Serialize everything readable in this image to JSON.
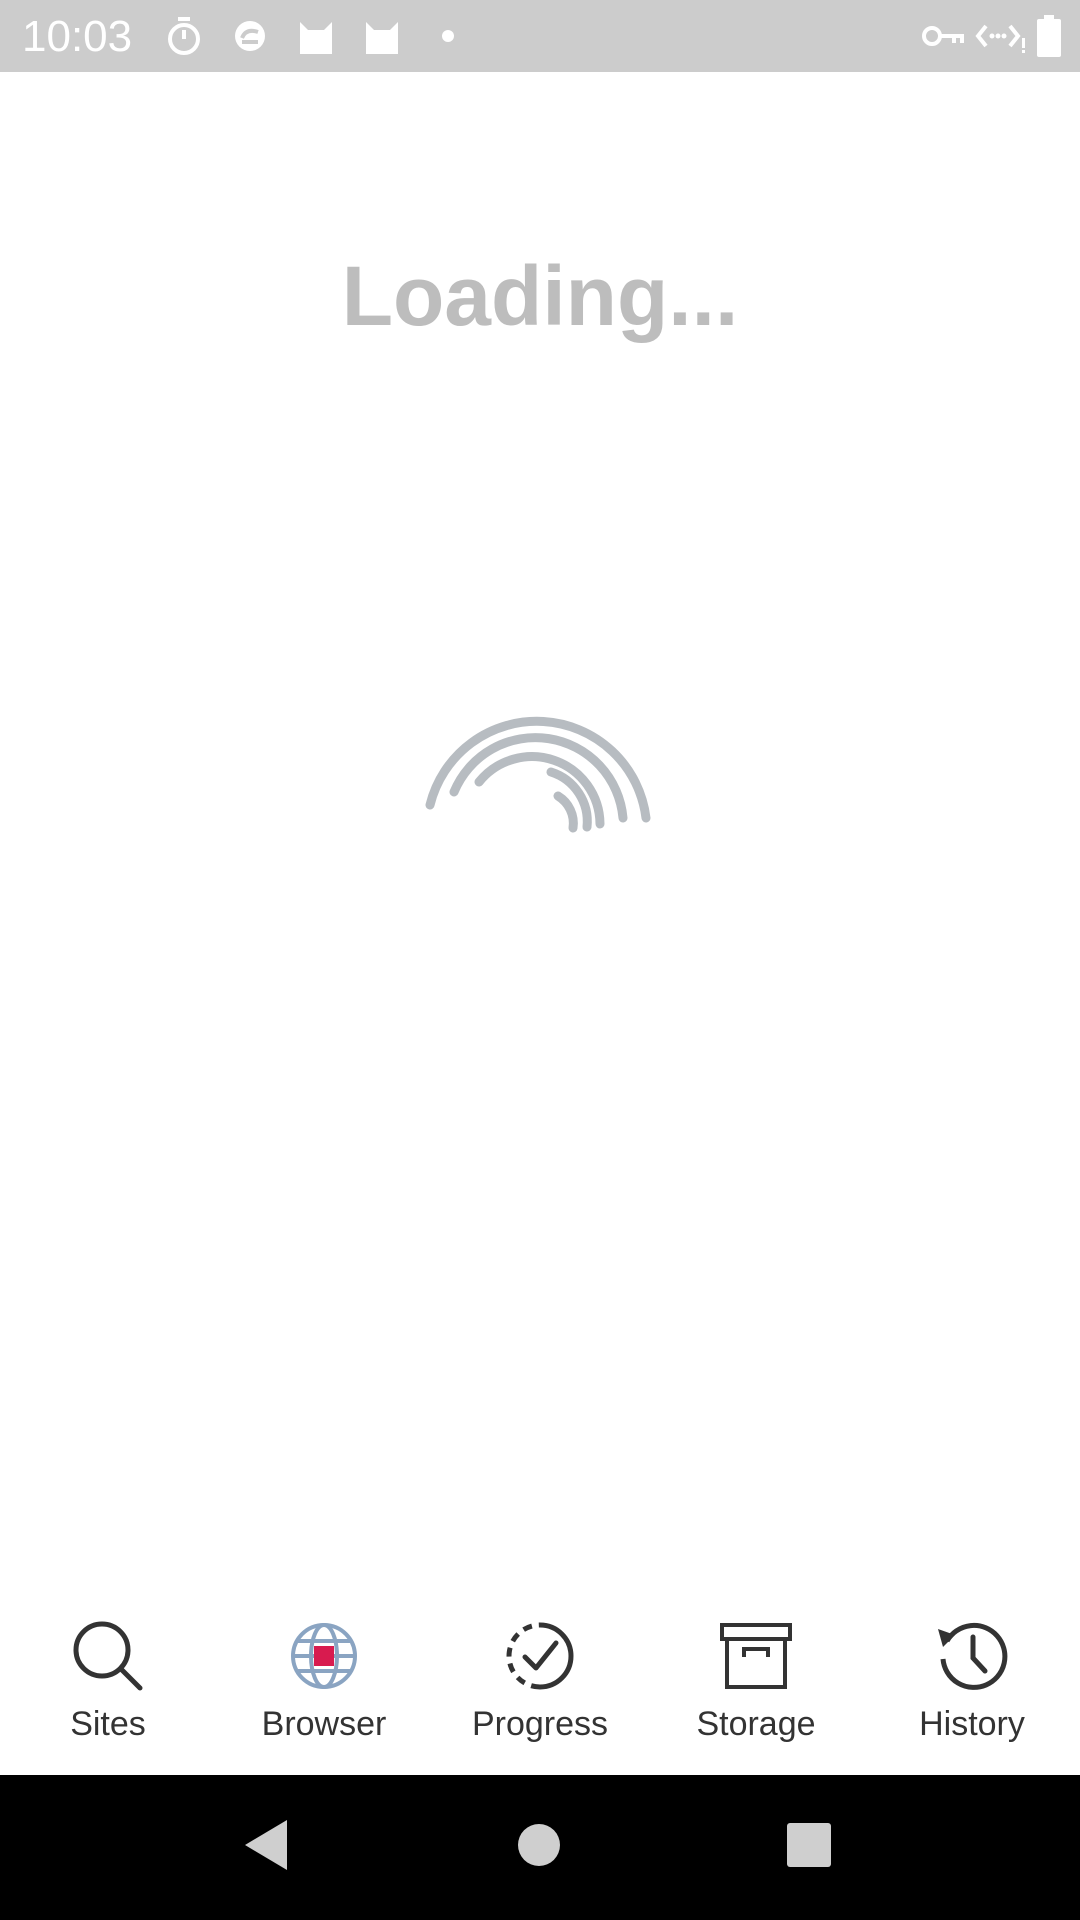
{
  "status_bar": {
    "time": "10:03",
    "left_icons": [
      "timer-icon",
      "sync-icon",
      "cat-app-icon",
      "cat-app-icon",
      "dot-icon"
    ],
    "right_icons": [
      "vpn-key-icon",
      "data-saver-icon",
      "battery-icon"
    ]
  },
  "main": {
    "loading_text": "Loading..."
  },
  "bottom_nav": {
    "items": [
      {
        "label": "Sites",
        "icon": "search-icon"
      },
      {
        "label": "Browser",
        "icon": "globe-icon"
      },
      {
        "label": "Progress",
        "icon": "progress-check-icon"
      },
      {
        "label": "Storage",
        "icon": "archive-box-icon"
      },
      {
        "label": "History",
        "icon": "history-clock-icon"
      }
    ]
  },
  "system_nav": {
    "buttons": [
      "back-icon",
      "home-icon",
      "recents-icon"
    ]
  },
  "colors": {
    "status_bar_bg": "#cccccc",
    "loading_text": "#bdbdbd",
    "spinner": "#b7bcc1",
    "nav_label": "#333333",
    "browser_accent": "#d81b4f",
    "browser_globe": "#8aa4c2",
    "system_nav_bg": "#000000"
  }
}
